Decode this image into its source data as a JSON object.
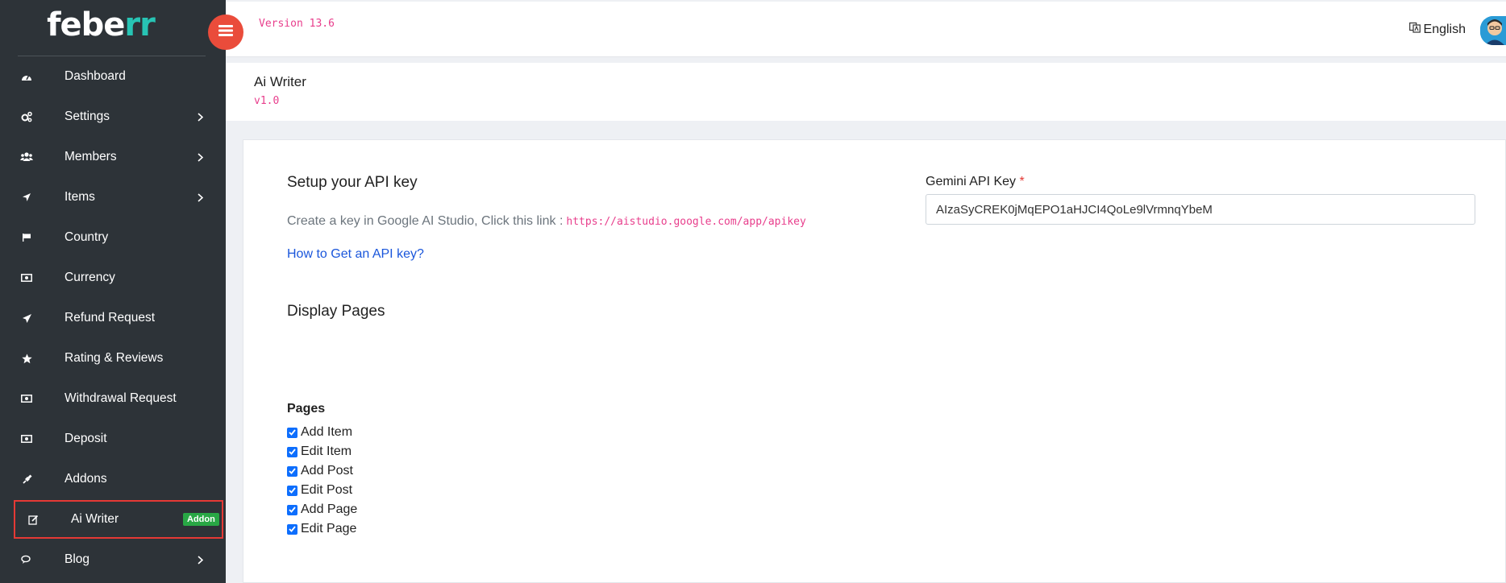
{
  "brand": {
    "name_main": "febe",
    "name_accent": "rr"
  },
  "topbar": {
    "version": "Version 13.6",
    "language": "English"
  },
  "sidebar": {
    "items": [
      {
        "label": "Dashboard",
        "icon": "dashboard-icon",
        "has_submenu": false
      },
      {
        "label": "Settings",
        "icon": "cogs-icon",
        "has_submenu": true
      },
      {
        "label": "Members",
        "icon": "users-icon",
        "has_submenu": true
      },
      {
        "label": "Items",
        "icon": "location-arrow-icon",
        "has_submenu": true
      },
      {
        "label": "Country",
        "icon": "flag-icon",
        "has_submenu": false
      },
      {
        "label": "Currency",
        "icon": "money-icon",
        "has_submenu": false
      },
      {
        "label": "Refund Request",
        "icon": "paper-plane-icon",
        "has_submenu": false
      },
      {
        "label": "Rating & Reviews",
        "icon": "star-icon",
        "has_submenu": false
      },
      {
        "label": "Withdrawal Request",
        "icon": "money-icon",
        "has_submenu": false
      },
      {
        "label": "Deposit",
        "icon": "money-icon",
        "has_submenu": false
      },
      {
        "label": "Addons",
        "icon": "plug-icon",
        "has_submenu": false
      },
      {
        "label": "Ai Writer",
        "icon": "edit-icon",
        "has_submenu": false,
        "badge": "Addon"
      },
      {
        "label": "Blog",
        "icon": "comments-icon",
        "has_submenu": true
      }
    ]
  },
  "page": {
    "title": "Ai Writer",
    "version": "v1.0"
  },
  "api_section": {
    "title": "Setup your API key",
    "help_text": "Create a key in Google AI Studio, Click this link :",
    "help_url": "https://aistudio.google.com/app/apikey",
    "help_link": "How to Get an API key?",
    "field_label": "Gemini API Key",
    "required_mark": "*",
    "api_key_value": "AIzaSyCREK0jMqEPO1aHJCI4QoLe9lVrmnqYbeM"
  },
  "display_section": {
    "title": "Display Pages",
    "pages_label": "Pages",
    "pages": [
      {
        "label": "Add Item",
        "checked": true
      },
      {
        "label": "Edit Item",
        "checked": true
      },
      {
        "label": "Add Post",
        "checked": true
      },
      {
        "label": "Edit Post",
        "checked": true
      },
      {
        "label": "Add Page",
        "checked": true
      },
      {
        "label": "Edit Page",
        "checked": true
      }
    ]
  },
  "colors": {
    "sidebar_bg": "#2d3338",
    "accent": "#27c4b4",
    "toggle": "#ea4c3b",
    "badge": "#28a745",
    "code": "#e83e8c",
    "link": "#1a56db"
  }
}
